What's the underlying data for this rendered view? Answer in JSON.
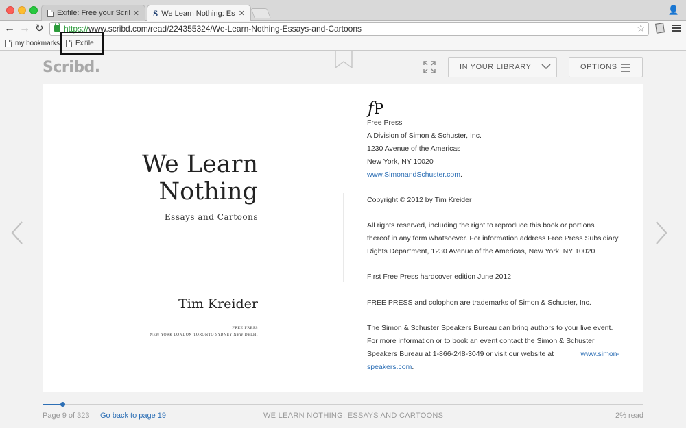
{
  "browser": {
    "tabs": [
      {
        "title": "Exifile: Free your Scribd his",
        "active": false
      },
      {
        "title": "We Learn Nothing: Essays a",
        "active": true
      }
    ],
    "url_scheme": "https://",
    "url_rest": "www.scribd.com/read/224355324/We-Learn-Nothing-Essays-and-Cartoons",
    "bookmarks": [
      "my bookmarks",
      "Exifile"
    ]
  },
  "header": {
    "logo": "Scribd.",
    "library_button": "IN YOUR LIBRARY",
    "options_button": "OPTIONS"
  },
  "book": {
    "title_line1": "We Learn",
    "title_line2": "Nothing",
    "subtitle": "Essays and Cartoons",
    "author": "Tim Kreider",
    "publisher_small": "FREE PRESS",
    "cities": "NEW YORK   LONDON   TORONTO   SYDNEY   NEW DELHI",
    "fp_logo_f": "f",
    "fp_logo_p": "P",
    "copyright": {
      "p1": "Free Press",
      "p2": "A Division of Simon & Schuster, Inc.",
      "p3": "1230 Avenue of the Americas",
      "p4": "New York, NY 10020",
      "p5": "www.SimonandSchuster.com",
      "p5_end": ".",
      "p6": "Copyright © 2012 by Tim Kreider",
      "p7_l1": "All rights reserved, including the right to reproduce this book or portions",
      "p7_l2": "thereof in any form whatsoever. For information address Free Press Subsidiary",
      "p7_l3": "Rights Department, 1230 Avenue of the Americas, New York, NY 10020",
      "p8": "First Free Press hardcover edition June 2012",
      "p9": "FREE PRESS and colophon are trademarks of Simon & Schuster, Inc.",
      "p10_l1": "The Simon & Schuster Speakers Bureau can bring authors to your live event.",
      "p10_l2": "For more information or to book an event contact the Simon & Schuster",
      "p10_l3": "Speakers Bureau at 1-866-248-3049 or visit our website at",
      "p10_link1": "www.simon-",
      "p10_link2": "speakers.com",
      "p10_end": "."
    }
  },
  "footer": {
    "page_text": "Page 9 of 323",
    "back_link": "Go back to page 19",
    "book_title": "WE LEARN NOTHING: ESSAYS AND CARTOONS",
    "read_text": "2% read",
    "progress": 0.033
  }
}
